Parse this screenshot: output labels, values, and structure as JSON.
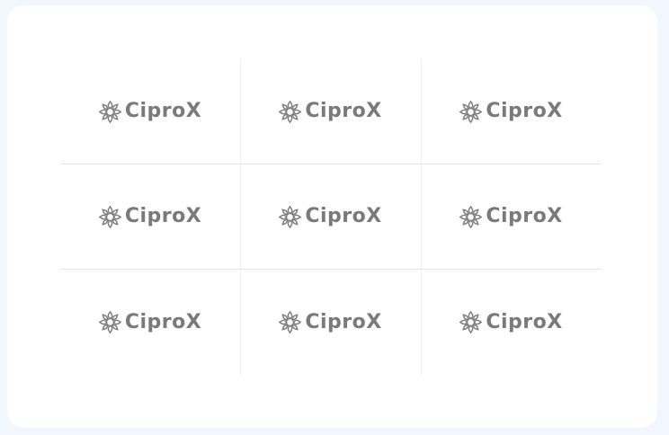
{
  "logos": [
    {
      "name": "CiproX",
      "icon": "flower-icon"
    },
    {
      "name": "CiproX",
      "icon": "flower-icon"
    },
    {
      "name": "CiproX",
      "icon": "flower-icon"
    },
    {
      "name": "CiproX",
      "icon": "flower-icon"
    },
    {
      "name": "CiproX",
      "icon": "flower-icon"
    },
    {
      "name": "CiproX",
      "icon": "flower-icon"
    },
    {
      "name": "CiproX",
      "icon": "flower-icon"
    },
    {
      "name": "CiproX",
      "icon": "flower-icon"
    },
    {
      "name": "CiproX",
      "icon": "flower-icon"
    }
  ],
  "colors": {
    "background": "#f2f6fe",
    "card": "#ffffff",
    "logo": "#7a7a7a",
    "divider": "#e3e5e8"
  }
}
